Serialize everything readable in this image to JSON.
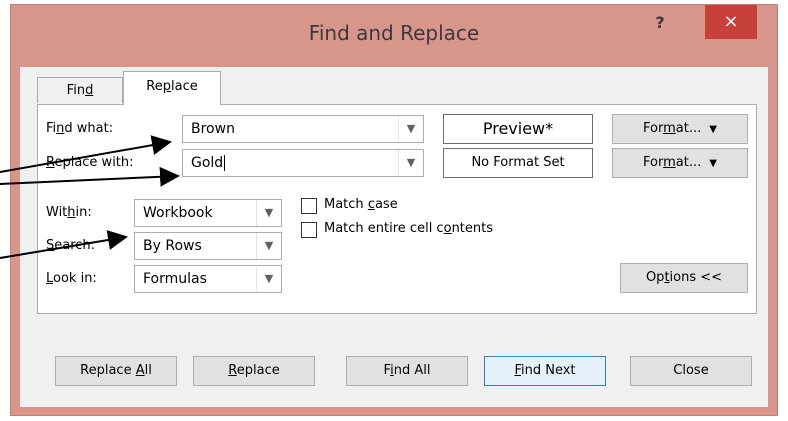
{
  "window": {
    "title": "Find and Replace",
    "help_label": "?",
    "close_label": "×"
  },
  "tabs": [
    {
      "label_pre": "Fin",
      "label_u": "d",
      "label_post": ""
    },
    {
      "label_pre": "Re",
      "label_u": "p",
      "label_post": "lace"
    }
  ],
  "replace": {
    "find_label_pre": "Fi",
    "find_label_u": "n",
    "find_label_post": "d what:",
    "find_value": "Brown",
    "preview_label": "Preview*",
    "replace_label_u": "R",
    "replace_label_post": "eplace with:",
    "replace_value": "Gold",
    "no_format_label": "No Format Set",
    "format_label_pre": "For",
    "format_label_u": "m",
    "format_label_post": "at...",
    "within_label_pre": "Wit",
    "within_label_u": "h",
    "within_label_post": "in:",
    "within_value": "Workbook",
    "search_label_u": "S",
    "search_label_post": "earch:",
    "search_value": "By Rows",
    "lookin_label_u": "L",
    "lookin_label_post": "ook in:",
    "lookin_value": "Formulas",
    "match_case_pre": "Match ",
    "match_case_u": "c",
    "match_case_post": "ase",
    "match_entire_pre": "Match entire cell c",
    "match_entire_u": "o",
    "match_entire_post": "ntents",
    "options_pre": "Op",
    "options_u": "t",
    "options_post": "ions <<"
  },
  "buttons": {
    "replace_all_pre": "Replace ",
    "replace_all_u": "A",
    "replace_all_post": "ll",
    "replace_u": "R",
    "replace_post": "eplace",
    "find_all_pre": "F",
    "find_all_u": "i",
    "find_all_post": "nd All",
    "find_next_u": "F",
    "find_next_post": "ind Next",
    "close_label": "Close"
  },
  "icons": {
    "dropdown": "chevron-down-icon",
    "split_arrow": "triangle-down-icon"
  },
  "colors": {
    "frame": "#d8958c",
    "close_button": "#c7403a",
    "client": "#f0f0f0"
  }
}
